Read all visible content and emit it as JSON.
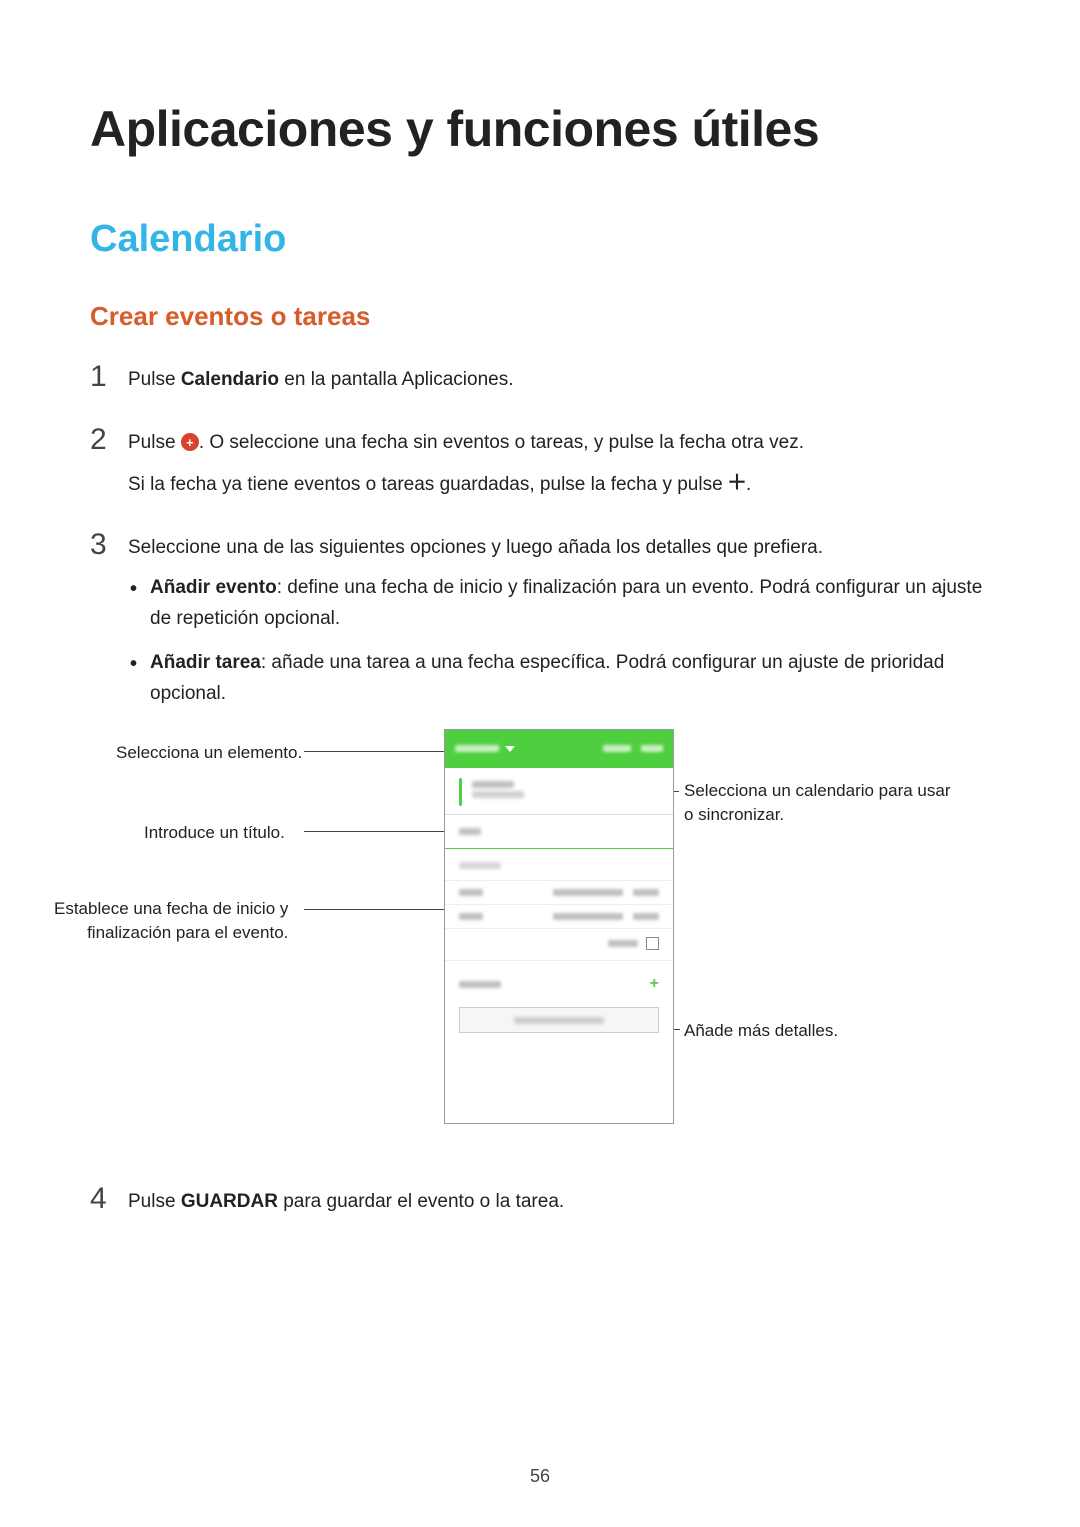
{
  "page_number": "56",
  "h1": "Aplicaciones y funciones útiles",
  "h2": "Calendario",
  "h3": "Crear eventos o tareas",
  "steps": {
    "s1": {
      "num": "1",
      "pre": "Pulse ",
      "bold": "Calendario",
      "post": " en la pantalla Aplicaciones."
    },
    "s2": {
      "num": "2",
      "line1_pre": "Pulse ",
      "line1_post": ". O seleccione una fecha sin eventos o tareas, y pulse la fecha otra vez.",
      "line2_pre": "Si la fecha ya tiene eventos o tareas guardadas, pulse la fecha y pulse ",
      "line2_post": "."
    },
    "s3": {
      "num": "3",
      "intro": "Seleccione una de las siguientes opciones y luego añada los detalles que prefiera.",
      "b1": {
        "bold": "Añadir evento",
        "rest": ": define una fecha de inicio y finalización para un evento. Podrá configurar un ajuste de repetición opcional."
      },
      "b2": {
        "bold": "Añadir tarea",
        "rest": ": añade una tarea a una fecha específica. Podrá configurar un ajuste de prioridad opcional."
      }
    },
    "s4": {
      "num": "4",
      "pre": "Pulse ",
      "bold": "GUARDAR",
      "post": " para guardar el evento o la tarea."
    }
  },
  "callouts": {
    "select_item": "Selecciona un elemento.",
    "enter_title": "Introduce un título.",
    "set_dates_l1": "Establece una fecha de inicio y",
    "set_dates_l2": "finalización para el evento.",
    "select_cal_l1": "Selecciona un calendario para usar",
    "select_cal_l2": "o sincronizar.",
    "more_details": "Añade más detalles."
  }
}
